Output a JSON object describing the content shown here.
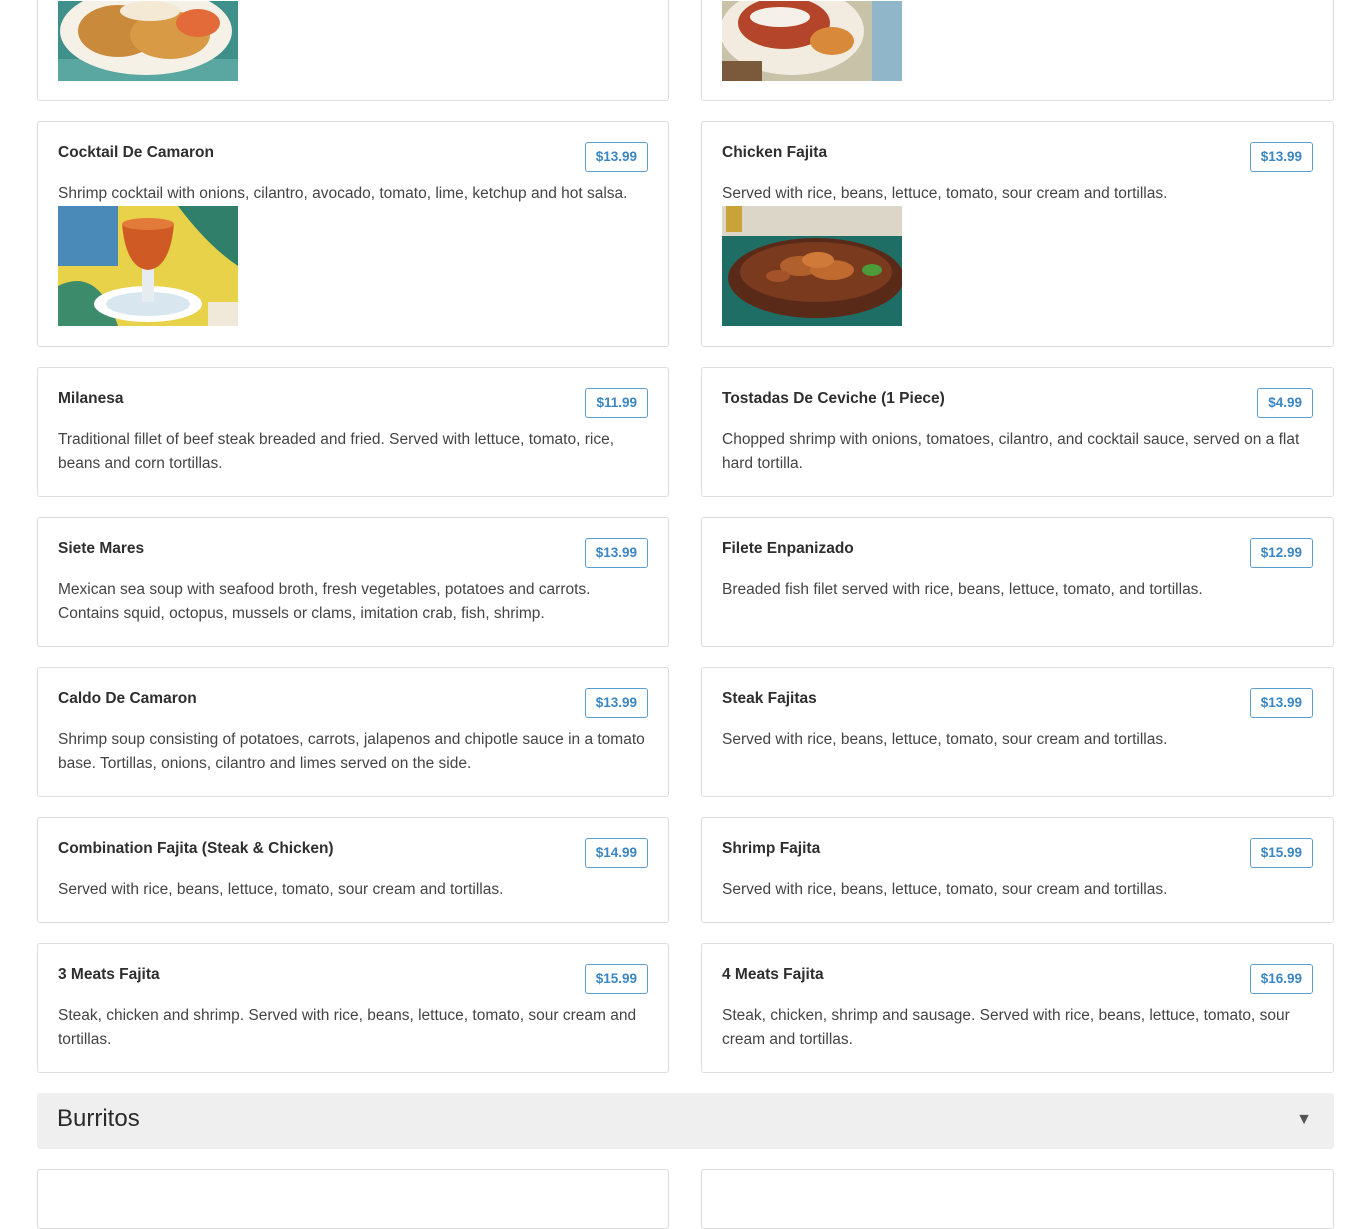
{
  "colors": {
    "price_border": "#5b9fd1",
    "price_text": "#3b86c4",
    "section_bg": "#efefef"
  },
  "items": [
    {
      "title": "Cocktail De Camaron",
      "price": "$13.99",
      "description": "Shrimp cocktail with onions, cilantro, avocado, tomato, lime, ketchup and hot salsa."
    },
    {
      "title": "Chicken Fajita",
      "price": "$13.99",
      "description": "Served with rice, beans, lettuce, tomato, sour cream and tortillas."
    },
    {
      "title": "Milanesa",
      "price": "$11.99",
      "description": "Traditional fillet of beef steak breaded and fried. Served with lettuce, tomato, rice, beans and corn tortillas."
    },
    {
      "title": "Tostadas De Ceviche (1 Piece)",
      "price": "$4.99",
      "description": "Chopped shrimp with onions, tomatoes, cilantro, and cocktail sauce, served on a flat hard tortilla."
    },
    {
      "title": "Siete Mares",
      "price": "$13.99",
      "description": "Mexican sea soup with seafood broth, fresh vegetables, potatoes and carrots. Contains squid, octopus, mussels or clams, imitation crab, fish, shrimp."
    },
    {
      "title": "Filete Enpanizado",
      "price": "$12.99",
      "description": "Breaded fish filet served with rice, beans, lettuce, tomato, and tortillas."
    },
    {
      "title": "Caldo De Camaron",
      "price": "$13.99",
      "description": "Shrimp soup consisting of potatoes, carrots, jalapenos and chipotle sauce in a tomato base. Tortillas, onions, cilantro and limes served on the side."
    },
    {
      "title": "Steak Fajitas",
      "price": "$13.99",
      "description": "Served with rice, beans, lettuce, tomato, sour cream and tortillas."
    },
    {
      "title": "Combination Fajita (Steak & Chicken)",
      "price": "$14.99",
      "description": "Served with rice, beans, lettuce, tomato, sour cream and tortillas."
    },
    {
      "title": "Shrimp Fajita",
      "price": "$15.99",
      "description": "Served with rice, beans, lettuce, tomato, sour cream and tortillas."
    },
    {
      "title": "3 Meats Fajita",
      "price": "$15.99",
      "description": "Steak, chicken and shrimp. Served with rice, beans, lettuce, tomato, sour cream and tortillas."
    },
    {
      "title": "4 Meats Fajita",
      "price": "$16.99",
      "description": "Steak, chicken, shrimp and sausage. Served with rice, beans, lettuce, tomato, sour cream and tortillas."
    }
  ],
  "section": {
    "title": "Burritos",
    "toggle_icon": "caret-down-icon",
    "toggle_glyph": "▼"
  }
}
